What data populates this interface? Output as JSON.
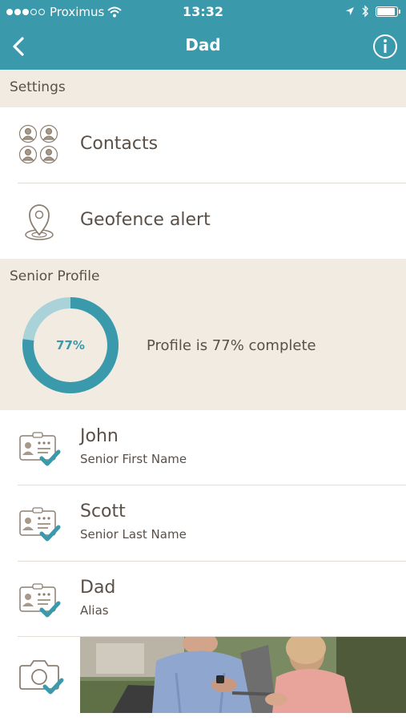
{
  "status_bar": {
    "carrier": "Proximus",
    "time": "13:32",
    "signal_dots_filled": 3,
    "signal_dots_total": 5,
    "icons": [
      "wifi-icon",
      "location-arrow-icon",
      "bluetooth-icon",
      "battery-icon"
    ]
  },
  "navbar": {
    "title": "Dad",
    "back_icon": "chevron-left-icon",
    "info_icon": "info-icon"
  },
  "settings": {
    "header": "Settings",
    "items": [
      {
        "label": "Contacts",
        "icon": "contacts-icon"
      },
      {
        "label": "Geofence alert",
        "icon": "location-pin-icon"
      }
    ]
  },
  "senior_profile": {
    "header": "Senior Profile",
    "completion_percent": 77,
    "completion_label": "77%",
    "completion_text": "Profile is 77% complete"
  },
  "profile_fields": [
    {
      "value": "John",
      "label": "Senior First Name",
      "icon": "id-card-check-icon"
    },
    {
      "value": "Scott",
      "label": "Senior Last Name",
      "icon": "id-card-check-icon"
    },
    {
      "value": "Dad",
      "label": "Alias",
      "icon": "id-card-check-icon"
    }
  ],
  "photo_row": {
    "icon": "camera-check-icon"
  },
  "colors": {
    "accent": "#3a9aac",
    "accent_light": "#a9d3d9",
    "section_bg": "#f2ebe2",
    "text": "#5a5048",
    "icon": "#a89a8a"
  }
}
